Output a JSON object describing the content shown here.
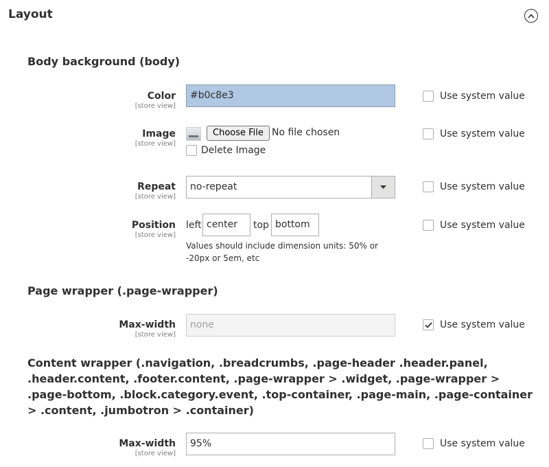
{
  "section": {
    "title": "Layout",
    "collapse_icon": "chevron-up-circle-icon"
  },
  "groups": {
    "body_background": {
      "title": "Body background (body)"
    },
    "page_wrapper": {
      "title": "Page wrapper (.page-wrapper)"
    },
    "content_wrapper": {
      "title": "Content wrapper (.navigation, .breadcrumbs, .page-header .header.panel, .header.content, .footer.content, .page-wrapper > .widget, .page-wrapper > .page-bottom, .block.category.event, .top-container, .page-main, .page-container > .content, .jumbotron > .container)"
    }
  },
  "scope_label": "[store view]",
  "use_system_label": "Use system value",
  "fields": {
    "color": {
      "label": "Color",
      "value": "#b0c8e3",
      "use_system": false
    },
    "image": {
      "label": "Image",
      "choose_label": "Choose File",
      "no_file_label": "No file chosen",
      "delete_label": "Delete Image",
      "use_system": false
    },
    "repeat": {
      "label": "Repeat",
      "value": "no-repeat",
      "use_system": false
    },
    "position": {
      "label": "Position",
      "left_label": "left",
      "left_value": "center",
      "top_label": "top",
      "top_value": "bottom",
      "note": "Values should include dimension units: 50% or -20px or 5em, etc",
      "use_system": false
    },
    "page_max_width": {
      "label": "Max-width",
      "value": "none",
      "use_system": true
    },
    "content_max_width": {
      "label": "Max-width",
      "value": "95%",
      "use_system": false
    }
  },
  "colors": {
    "color_swatch": "#b0c8e3",
    "text": "#303030",
    "border": "#adadad"
  }
}
